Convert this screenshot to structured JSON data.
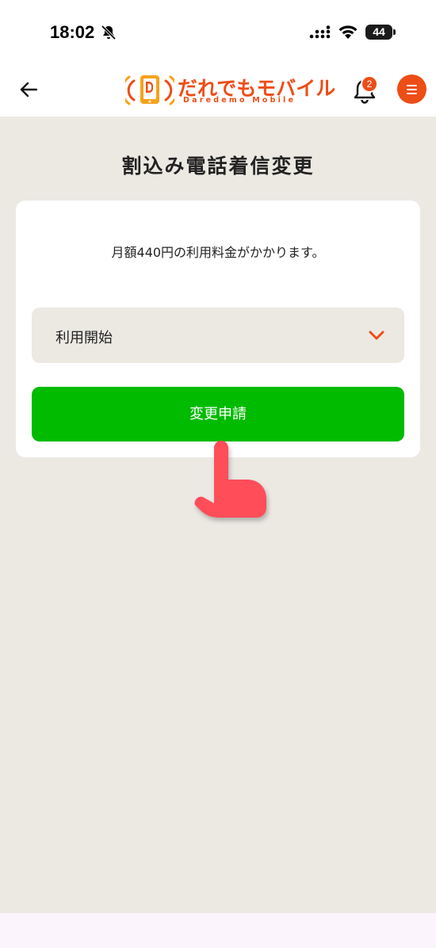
{
  "status_bar": {
    "time": "18:02",
    "battery": "44"
  },
  "header": {
    "logo_text": "だれでもモバイル",
    "logo_subtext": "Daredemo Mobile",
    "notification_count": "2"
  },
  "page": {
    "title": "割込み電話着信変更",
    "fee_note": "月額440円の利用料金がかかります。",
    "select_value": "利用開始",
    "submit_label": "変更申請"
  },
  "colors": {
    "brand_orange": "#ee4d16",
    "button_green": "#00bb00",
    "background": "#ece9e3",
    "pointer_red": "#ff4d5a"
  },
  "icons": [
    "mute-icon",
    "signal-icon",
    "wifi-icon",
    "back-arrow-icon",
    "phone-logo-icon",
    "bell-icon",
    "hamburger-icon",
    "chevron-down-icon",
    "pointing-hand-icon"
  ]
}
